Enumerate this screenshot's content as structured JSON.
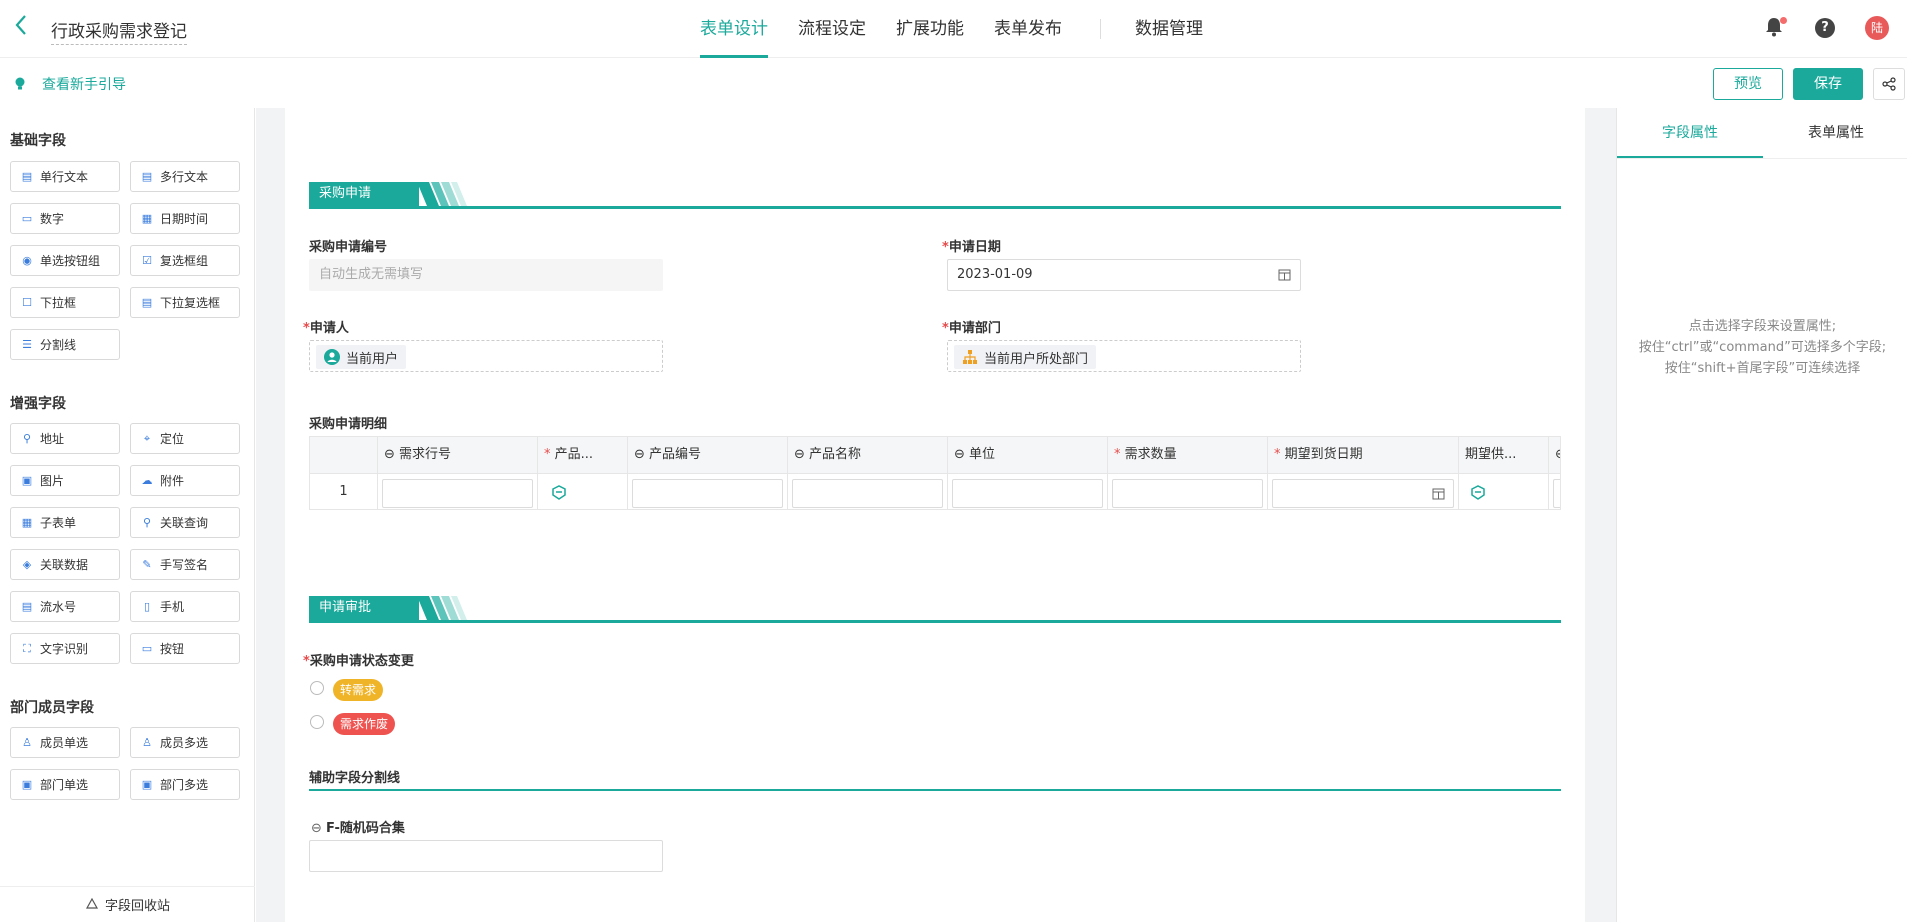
{
  "header": {
    "back_icon": "chevron-left-icon",
    "title": "行政采购需求登记",
    "tabs": [
      "表单设计",
      "流程设定",
      "扩展功能",
      "表单发布"
    ],
    "data_tab": "数据管理",
    "avatar_text": "陆"
  },
  "toolbar": {
    "guide": "查看新手引导",
    "preview": "预览",
    "save": "保存"
  },
  "left_panel": {
    "basic_title": "基础字段",
    "basic": [
      "单行文本",
      "多行文本",
      "数字",
      "日期时间",
      "单选按钮组",
      "复选框组",
      "下拉框",
      "下拉复选框",
      "分割线"
    ],
    "enhanced_title": "增强字段",
    "enhanced": [
      "地址",
      "定位",
      "图片",
      "附件",
      "子表单",
      "关联查询",
      "关联数据",
      "手写签名",
      "流水号",
      "手机",
      "文字识别",
      "按钮"
    ],
    "member_title": "部门成员字段",
    "member": [
      "成员单选",
      "成员多选",
      "部门单选",
      "部门多选"
    ],
    "recycle": "字段回收站"
  },
  "form": {
    "section1": "采购申请",
    "req_no_label": "采购申请编号",
    "req_no_placeholder": "自动生成无需填写",
    "date_label": "申请日期",
    "date_value": "2023-01-09",
    "applicant_label": "申请人",
    "applicant_value": "当前用户",
    "dept_label": "申请部门",
    "dept_value": "当前用户所处部门",
    "detail_label": "采购申请明细",
    "columns": [
      "需求行号",
      "产品...",
      "产品编号",
      "产品名称",
      "单位",
      "需求数量",
      "期望到货日期",
      "期望供..."
    ],
    "row_index": "1",
    "section2": "申请审批",
    "status_label": "采购申请状态变更",
    "status_options": [
      "转需求",
      "需求作废"
    ],
    "divider_label": "辅助字段分割线",
    "random_label": "F-随机码合集"
  },
  "right_panel": {
    "tab1": "字段属性",
    "tab2": "表单属性",
    "hint1": "点击选择字段来设置属性;",
    "hint2": "按住“ctrl”或“command”可选择多个字段;",
    "hint3": "按住“shift+首尾字段”可连续选择"
  },
  "colors": {
    "accent": "#1aa99b",
    "yellow_pill": "#f0b429",
    "red_pill": "#ef5350"
  }
}
